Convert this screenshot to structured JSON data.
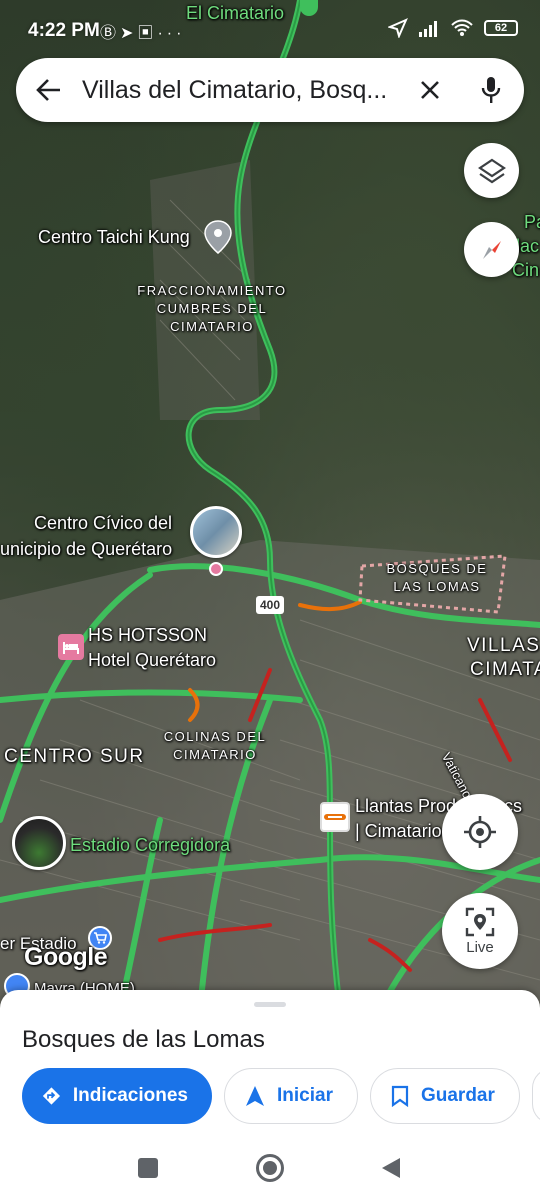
{
  "status_bar": {
    "time": "4:22 PM",
    "battery": "62",
    "left_icons": [
      "notification-b-icon",
      "telegram-icon",
      "chat-icon",
      "more-dots-icon"
    ],
    "right_icons": [
      "location-arrow-icon",
      "signal-icon",
      "wifi-icon",
      "battery-icon"
    ]
  },
  "search": {
    "query": "Villas del Cimatario, Bosq..."
  },
  "map": {
    "labels": {
      "el_cimatario": "El Cimatario",
      "taichi": "Centro Taichi Kung",
      "fracc_1": "FRACCIONAMIENTO",
      "fracc_2": "CUMBRES DEL",
      "fracc_3": "CIMATARIO",
      "civico_1": "Centro Cívico del",
      "civico_2": "unicipio de Querétaro",
      "bosques_1": "BOSQUES DE",
      "bosques_2": "LAS LOMAS",
      "road_400": "400",
      "hotsson_1": "HS HOTSSON",
      "hotsson_2": "Hotel Querétaro",
      "villas_1": "VILLAS",
      "villas_2": "CIMATA",
      "colinas_1": "COLINAS DEL",
      "colinas_2": "CIMATARIO",
      "centro_sur": "CENTRO SUR",
      "vaticano": "Vaticano",
      "llantas_1": "Llantas Prod",
      "llantas_1b": "cs",
      "llantas_2": "| Cimatario",
      "estadio": "Estadio Corregidora",
      "estadio_small": "er Estadio",
      "mayra": "Mayra (HOME)",
      "edge_p": "Pa",
      "edge_lac": "lac",
      "edge_cin": "Cin",
      "watermark": "Google"
    },
    "live_label": "Live"
  },
  "place": {
    "name": "Bosques de las Lomas",
    "actions": {
      "directions": "Indicaciones",
      "start": "Iniciar",
      "save": "Guardar"
    }
  },
  "colors": {
    "accent": "#1a73e8",
    "traffic_green": "#3fbf5c",
    "traffic_red": "#c5221f",
    "traffic_orange": "#e8710a"
  }
}
